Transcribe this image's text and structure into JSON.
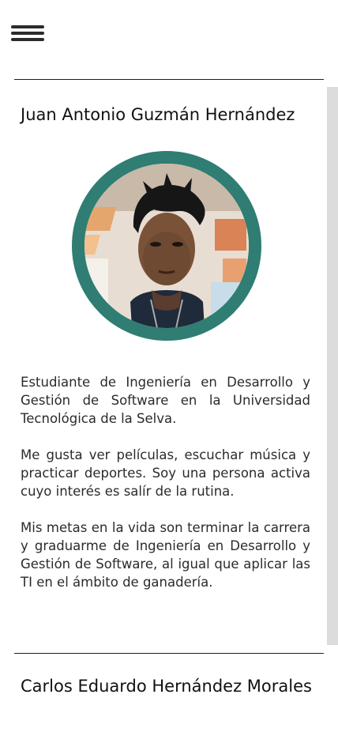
{
  "header": {
    "menu_icon": "hamburger-menu-icon"
  },
  "profiles": [
    {
      "name": "Juan Antonio Guzmán Hernández",
      "photo": "profile-photo",
      "bio": [
        "Estudiante de Ingeniería en Desarrollo y Gestión de Software en la Universidad Tecnológica de la Selva.",
        "Me gusta ver películas, escuchar música y practicar deportes. Soy una persona activa cuyo interés es salír de la rutina.",
        "Mis metas en la vida son terminar la carrera y graduarme de Ingeniería en Desarrollo y Gestión de Software, al igual que aplicar las TI en el ámbito de ganadería."
      ]
    },
    {
      "name": "Carlos Eduardo Hernández Morales"
    }
  ],
  "colors": {
    "avatar_ring": "#2f7d73",
    "divider": "#1f1f1f",
    "scrollbar": "#dcdcdc"
  }
}
